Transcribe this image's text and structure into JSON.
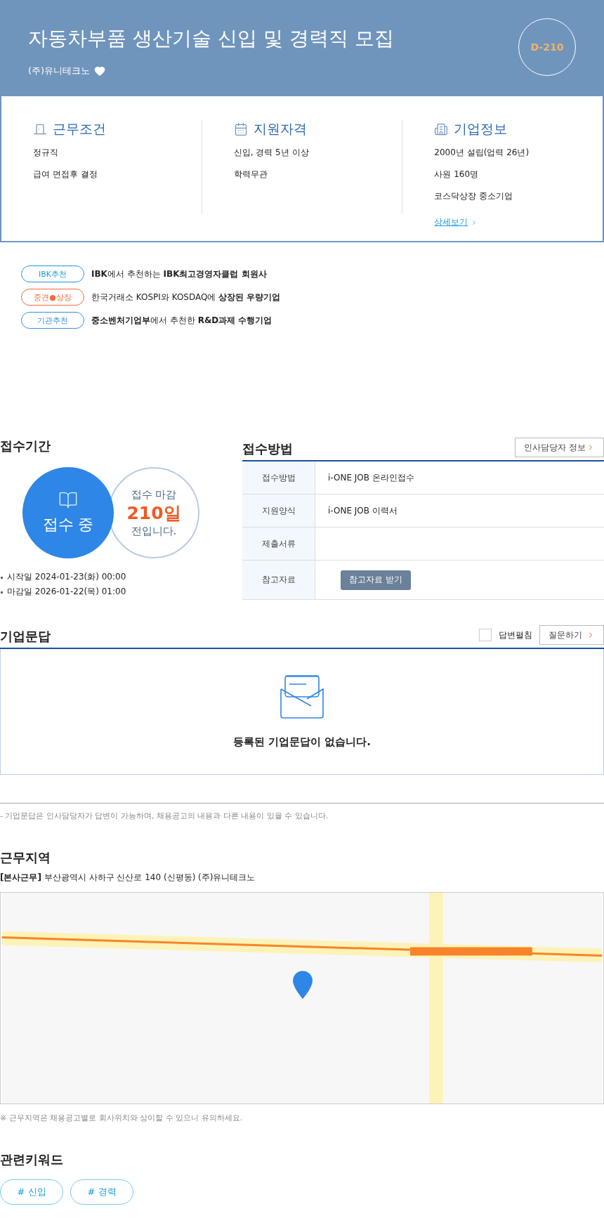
{
  "header": {
    "title": "자동차부품 생산기술 신입 및 경력직 모집",
    "company": "(주)유니테크노",
    "dday": "D-210"
  },
  "summary": [
    {
      "kind": "work",
      "title": "근무조건",
      "lines": [
        "정규직",
        "급여 면접후 결정"
      ]
    },
    {
      "kind": "qualify",
      "title": "지원자격",
      "lines": [
        "신입, 경력 5년 이상",
        "학력무관"
      ]
    },
    {
      "kind": "company",
      "title": "기업정보",
      "lines": [
        "2000년 설립(업력 26년)",
        "사원 160명",
        "코스닥상장 중소기업"
      ],
      "link": "상세보기"
    }
  ],
  "badges": [
    {
      "label": "IBK추천",
      "color": "#1a9be0",
      "text": "**IBK**에서 추천하는 **IBK최고경영자클럽 회원사**"
    },
    {
      "label": "중견●상장",
      "color": "#f26b3a",
      "text": "한국거래소 KOSPI와 KOSDAQ에 **상장된 우량기업**"
    },
    {
      "label": "기관추천",
      "color": "#3b8ee6",
      "text": "**중소벤처기업부**에서 추천한 **R&D과제 수행기업**"
    }
  ],
  "period": {
    "title": "접수기간",
    "status": "접수 중",
    "deadline_label": "접수 마감",
    "days": "210일",
    "suffix": "전입니다.",
    "dates": [
      "시작일 2024-01-23(화) 00:00",
      "마감일 2026-01-22(목) 01:00"
    ]
  },
  "method": {
    "title": "접수방법",
    "contact_button": "인사담당자 정보",
    "rows": [
      {
        "label": "접수방법",
        "value": "i-ONE JOB 온라인접수"
      },
      {
        "label": "지원양식",
        "value": "i-ONE JOB 이력서"
      },
      {
        "label": "제출서류"
      },
      {
        "label": "참고자료",
        "button": "참고자료 받기"
      }
    ]
  },
  "qna": {
    "title": "기업문답",
    "toggle": {
      "label": "답변펼침",
      "checked": false
    },
    "ask_button": "질문하기",
    "empty": "등록된 기업문답이 없습니다.",
    "note": "- 기업문답은 인사담당자가 답변이 가능하며, 채용공고의 내용과 다른 내용이 있을 수 있습니다."
  },
  "location": {
    "title": "근무지역",
    "address": "**[본사근무]** 부산광역시 사하구 신산로 140 (신평동) (주)유니테크노",
    "note": "※ 근무지역은 채용공고별로 회사위치와 상이할 수 있으니 유의하세요."
  },
  "keywords": {
    "title": "관련키워드",
    "items": [
      "# 신입",
      "# 경력"
    ]
  }
}
